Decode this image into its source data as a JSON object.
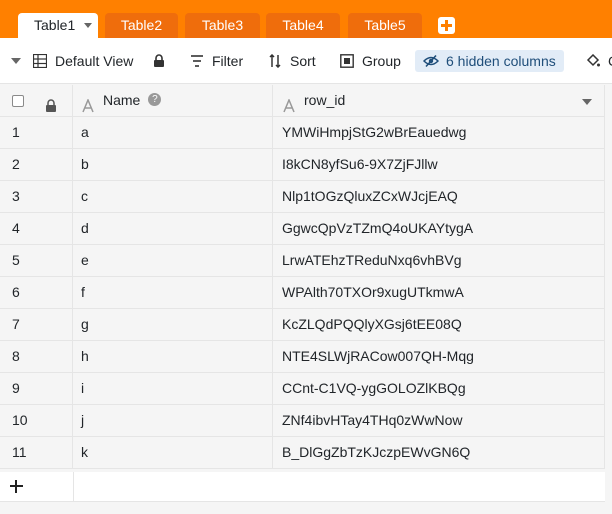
{
  "tabs": [
    {
      "label": "Table1",
      "active": true
    },
    {
      "label": "Table2",
      "active": false
    },
    {
      "label": "Table3",
      "active": false
    },
    {
      "label": "Table4",
      "active": false
    },
    {
      "label": "Table5",
      "active": false
    }
  ],
  "toolbar": {
    "view_label": "Default View",
    "filter_label": "Filter",
    "sort_label": "Sort",
    "group_label": "Group",
    "hidden_columns_label": "6 hidden columns",
    "cutoff_label": "C"
  },
  "columns": {
    "name": "Name",
    "row_id": "row_id"
  },
  "rows": [
    {
      "index": "1",
      "name": "a",
      "row_id": "YMWiHmpjStG2wBrEauedwg"
    },
    {
      "index": "2",
      "name": "b",
      "row_id": "I8kCN8yfSu6-9X7ZjFJllw"
    },
    {
      "index": "3",
      "name": "c",
      "row_id": "Nlp1tOGzQluxZCxWJcjEAQ"
    },
    {
      "index": "4",
      "name": "d",
      "row_id": "GgwcQpVzTZmQ4oUKAYtygA"
    },
    {
      "index": "5",
      "name": "e",
      "row_id": "LrwATEhzTReduNxq6vhBVg"
    },
    {
      "index": "6",
      "name": "f",
      "row_id": "WPAlth70TXOr9xugUTkmwA"
    },
    {
      "index": "7",
      "name": "g",
      "row_id": "KcZLQdPQQlyXGsj6tEE08Q"
    },
    {
      "index": "8",
      "name": "h",
      "row_id": "NTE4SLWjRACow007QH-Mqg"
    },
    {
      "index": "9",
      "name": "i",
      "row_id": "CCnt-C1VQ-ygGOLOZlKBQg"
    },
    {
      "index": "10",
      "name": "j",
      "row_id": "ZNf4ibvHTay4THq0zWwNow"
    },
    {
      "index": "11",
      "name": "k",
      "row_id": "B_DlGgZbTzKJczpEWvGN6Q"
    }
  ],
  "colors": {
    "tab_bar": "#ff8000",
    "tab_inactive": "#ef6d0c",
    "hidden_columns_bg": "#e2ecf7"
  },
  "icons": {
    "view": "grid-icon",
    "lock": "lock-icon",
    "filter": "filter-icon",
    "sort": "sort-icon",
    "group": "group-icon",
    "hidden": "eye-slash-icon",
    "cutoff": "paint-bucket-icon",
    "column_type": "text-column-icon",
    "help": "help-icon",
    "add_table": "plus-icon",
    "add_row": "plus-icon"
  }
}
